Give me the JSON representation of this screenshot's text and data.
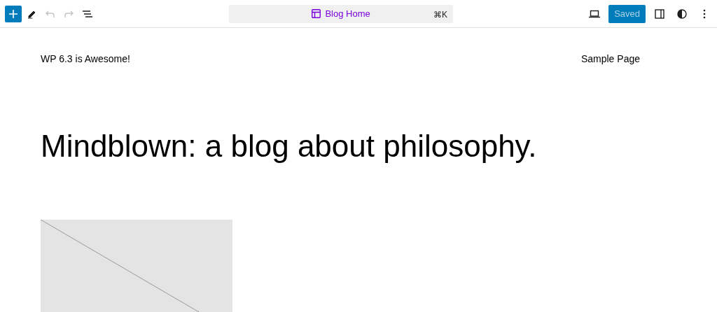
{
  "toolbar": {
    "left_tools": [
      {
        "kind": "add",
        "disabled": false
      },
      {
        "kind": "edit",
        "disabled": false
      },
      {
        "kind": "undo",
        "disabled": true
      },
      {
        "kind": "redo",
        "disabled": true
      },
      {
        "kind": "list",
        "disabled": false
      }
    ],
    "document_title": "Blog Home",
    "shortcut": "⌘K",
    "save_button": {
      "label": "Saved",
      "disabled": true
    },
    "right_tools": [
      {
        "kind": "device"
      },
      {
        "kind": "sidebar"
      },
      {
        "kind": "styles"
      },
      {
        "kind": "more"
      }
    ]
  },
  "site": {
    "title": "WP 6.3 is Awesome!",
    "nav": [
      "Sample Page"
    ]
  },
  "heading": "Mindblown: a blog about philosophy.",
  "posts": [
    {
      "kind": "placeholder"
    }
  ]
}
